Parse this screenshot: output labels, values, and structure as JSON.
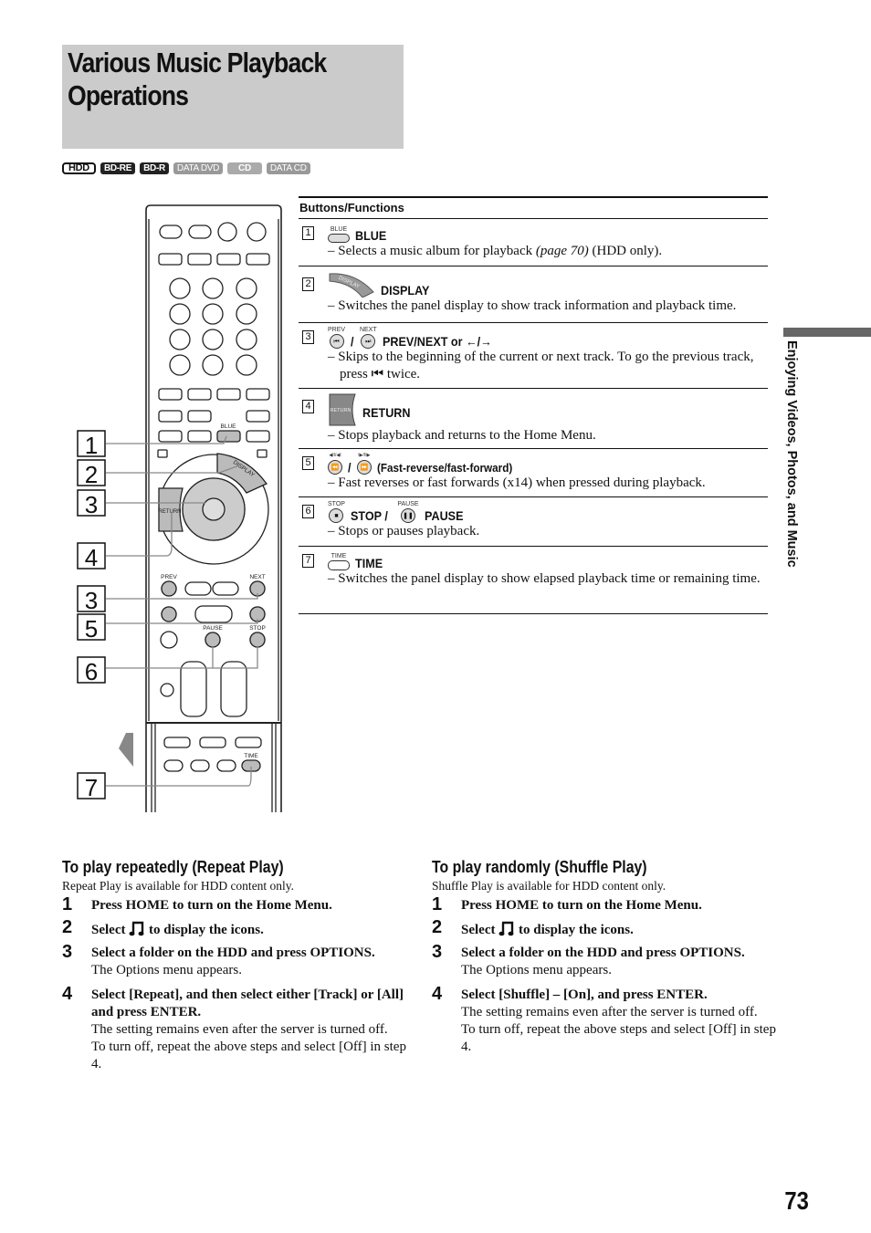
{
  "page": {
    "title_line1": "Various Music Playback",
    "title_line2": "Operations",
    "badges": [
      "HDD",
      "BD-RE",
      "BD-R",
      "DATA DVD",
      "CD",
      "DATA CD"
    ],
    "side_tab": "Enjoying Videos, Photos, and Music",
    "page_number": "73"
  },
  "remote": {
    "callouts": [
      "1",
      "2",
      "3",
      "4",
      "3",
      "5",
      "6",
      "7"
    ],
    "labels": {
      "blue": "BLUE",
      "display": "DISPLAY",
      "return": "RETURN",
      "prev": "PREV",
      "next": "NEXT",
      "pause": "PAUSE",
      "stop": "STOP",
      "time": "TIME"
    }
  },
  "buttons_functions": {
    "header": "Buttons/Functions",
    "rows": [
      {
        "num": "1",
        "icon_caption": "BLUE",
        "label": "BLUE",
        "desc": "– Selects a music album for playback",
        "desc_link": "(page 70)",
        "desc_tail": " (HDD only)."
      },
      {
        "num": "2",
        "icon_caption": "DISPLAY",
        "label": "DISPLAY",
        "desc": "– Switches the panel display to show track information and playback time."
      },
      {
        "num": "3",
        "icon_caption_a": "PREV",
        "icon_caption_b": "NEXT",
        "label": "PREV/NEXT or ←/→",
        "desc": "– Skips to the beginning of the current or next track. To go the previous track, press ⏮ twice."
      },
      {
        "num": "4",
        "icon_caption": "RETURN",
        "label": "RETURN",
        "desc": "– Stops playback and returns to the Home Menu."
      },
      {
        "num": "5",
        "icon_caption_a": "◀II/◀I",
        "icon_caption_b": "I▶/II▶",
        "label": "(Fast-reverse/fast-forward)",
        "desc": "– Fast reverses or fast forwards (x14) when pressed during playback."
      },
      {
        "num": "6",
        "icon_caption_a": "STOP",
        "icon_caption_b": "PAUSE",
        "label_a": "STOP /",
        "label_b": "PAUSE",
        "desc": "– Stops or pauses playback."
      },
      {
        "num": "7",
        "icon_caption": "TIME",
        "label": "TIME",
        "desc": "– Switches the panel display to show elapsed playback time or remaining time."
      }
    ]
  },
  "repeat": {
    "title": "To play repeatedly (Repeat Play)",
    "intro": "Repeat Play is available for HDD content only.",
    "steps": [
      {
        "num": "1",
        "main": "Press HOME to turn on the Home Menu."
      },
      {
        "num": "2",
        "main_a": "Select",
        "main_b": "to display the icons."
      },
      {
        "num": "3",
        "main": "Select a folder on the HDD and press OPTIONS.",
        "note": "The Options menu appears."
      },
      {
        "num": "4",
        "main": "Select [Repeat], and then select either [Track] or [All] and press ENTER.",
        "note": "The setting remains even after the server is turned off.",
        "note2": "To turn off, repeat the above steps and select [Off] in step 4."
      }
    ]
  },
  "shuffle": {
    "title": "To play randomly (Shuffle Play)",
    "intro": "Shuffle Play is available for HDD content only.",
    "steps": [
      {
        "num": "1",
        "main": "Press HOME to turn on the Home Menu."
      },
      {
        "num": "2",
        "main_a": "Select",
        "main_b": "to display the icons."
      },
      {
        "num": "3",
        "main": "Select a folder on the HDD and press OPTIONS.",
        "note": "The Options menu appears."
      },
      {
        "num": "4",
        "main": "Select [Shuffle] – [On], and press ENTER.",
        "note": "The setting remains even after the server is turned off.",
        "note2": "To turn off, repeat the above steps and select [Off] in step 4."
      }
    ]
  }
}
